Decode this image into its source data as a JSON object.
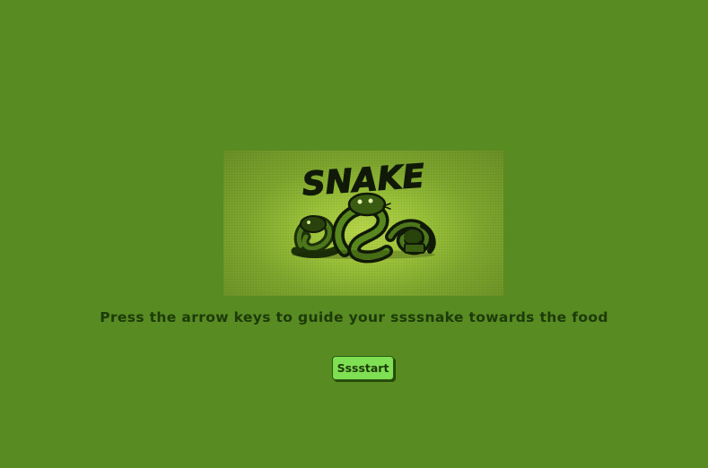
{
  "game": {
    "logo_text": "SNAKE",
    "instructions": "Press the arrow keys to guide your ssssnake towards the food",
    "start_label": "Sssstart"
  },
  "colors": {
    "background": "#588b22",
    "text": "#1d3a0a",
    "button": "#7ee052"
  },
  "icons": {
    "logo": "snake-logo-icon"
  }
}
